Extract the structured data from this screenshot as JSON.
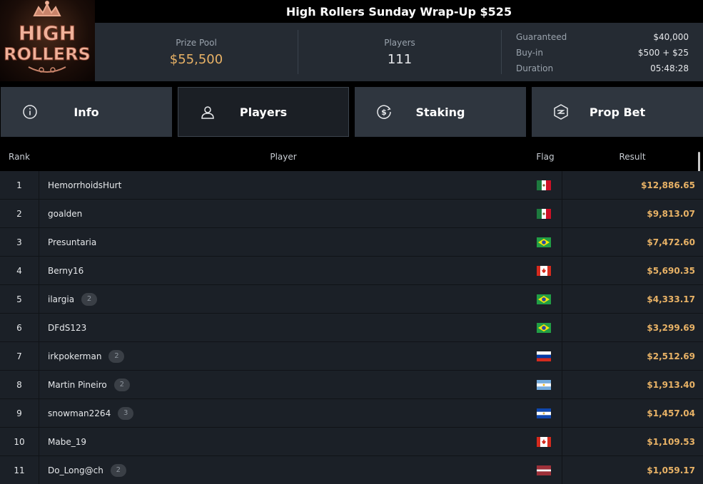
{
  "logo": {
    "line1": "HIGH",
    "line2": "ROLLERS"
  },
  "header": {
    "title": "High Rollers Sunday Wrap-Up $525"
  },
  "stats": {
    "prize_pool_label": "Prize Pool",
    "prize_pool_value": "$55,500",
    "players_label": "Players",
    "players_value": "111",
    "details": [
      {
        "label": "Guaranteed",
        "value": "$40,000"
      },
      {
        "label": "Buy-in",
        "value": "$500 + $25"
      },
      {
        "label": "Duration",
        "value": "05:48:28"
      }
    ]
  },
  "tabs": [
    {
      "label": "Info",
      "icon": "info-icon",
      "active": false
    },
    {
      "label": "Players",
      "icon": "user-icon",
      "active": true
    },
    {
      "label": "Staking",
      "icon": "dollar-coin-icon",
      "active": false
    },
    {
      "label": "Prop Bet",
      "icon": "prop-bet-icon",
      "active": false
    }
  ],
  "table": {
    "headers": {
      "rank": "Rank",
      "player": "Player",
      "flag": "Flag",
      "result": "Result"
    },
    "rows": [
      {
        "rank": "1",
        "player": "HemorrhoidsHurt",
        "badge": "",
        "flag": "mexico",
        "result": "$12,886.65"
      },
      {
        "rank": "2",
        "player": "goalden",
        "badge": "",
        "flag": "mexico",
        "result": "$9,813.07"
      },
      {
        "rank": "3",
        "player": "Presuntaria",
        "badge": "",
        "flag": "brazil",
        "result": "$7,472.60"
      },
      {
        "rank": "4",
        "player": "Berny16",
        "badge": "",
        "flag": "canada",
        "result": "$5,690.35"
      },
      {
        "rank": "5",
        "player": "ilargia",
        "badge": "2",
        "flag": "brazil",
        "result": "$4,333.17"
      },
      {
        "rank": "6",
        "player": "DFdS123",
        "badge": "",
        "flag": "brazil",
        "result": "$3,299.69"
      },
      {
        "rank": "7",
        "player": "irkpokerman",
        "badge": "2",
        "flag": "russia",
        "result": "$2,512.69"
      },
      {
        "rank": "8",
        "player": "Martin Pineiro",
        "badge": "2",
        "flag": "argentina",
        "result": "$1,913.40"
      },
      {
        "rank": "9",
        "player": "snowman2264",
        "badge": "3",
        "flag": "el-salvador",
        "result": "$1,457.04"
      },
      {
        "rank": "10",
        "player": "Mabe_19",
        "badge": "",
        "flag": "canada",
        "result": "$1,109.53"
      },
      {
        "rank": "11",
        "player": "Do_Long@ch",
        "badge": "2",
        "flag": "latvia",
        "result": "$1,059.17"
      }
    ]
  },
  "colors": {
    "accent_gold": "#e8b266",
    "panel": "#252b33",
    "row": "#1b2027",
    "tab": "#2f363f"
  }
}
